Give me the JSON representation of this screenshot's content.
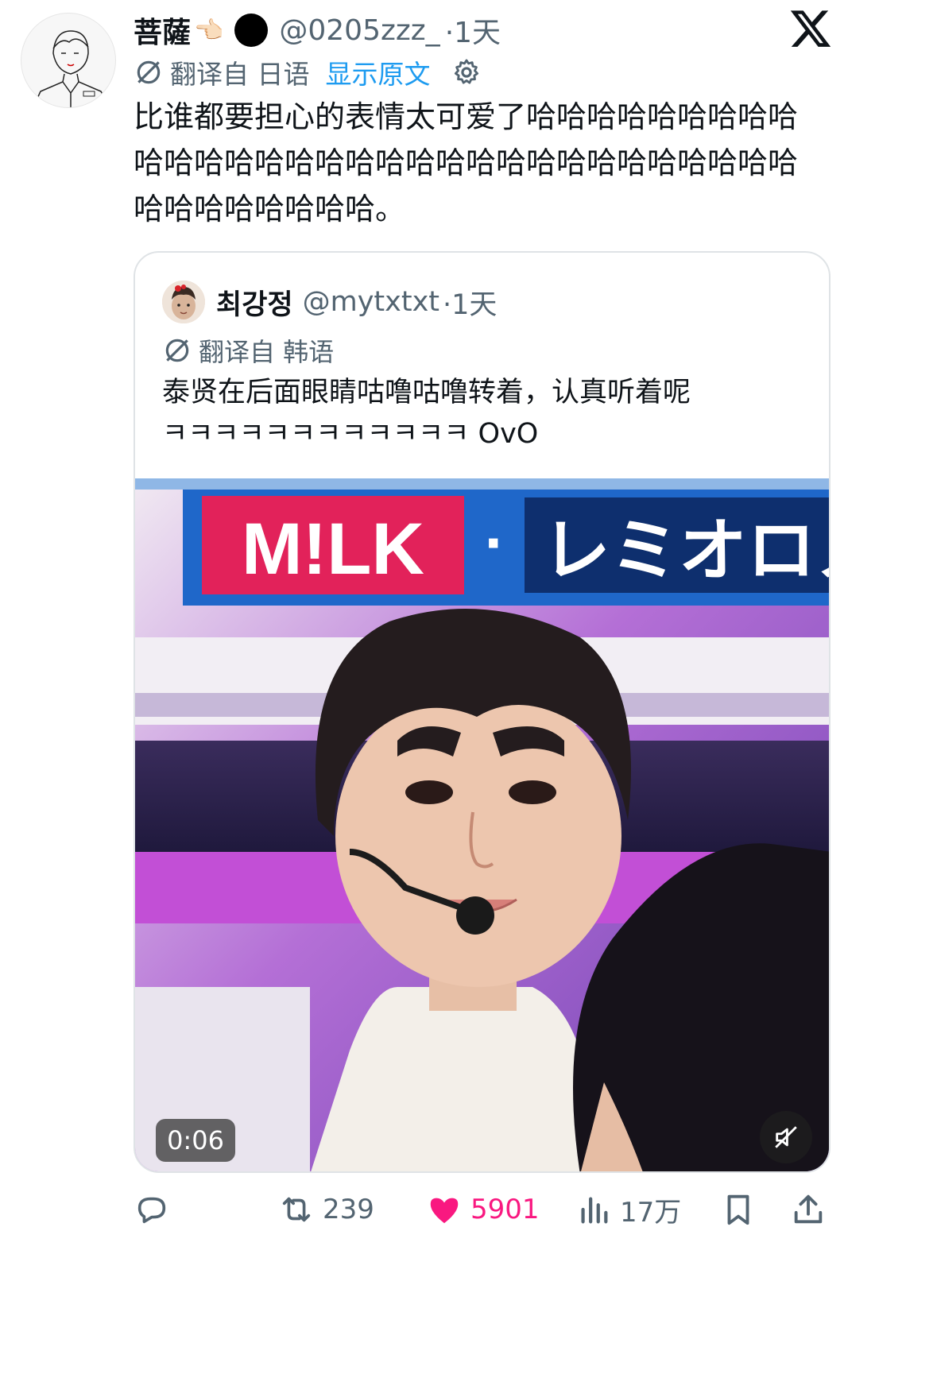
{
  "tweet": {
    "display_name": "菩薩",
    "handle": "@0205zzz_",
    "time": "·1天",
    "translation_label": "翻译自 日语",
    "show_original": "显示原文",
    "text": "比谁都要担心的表情太可爱了哈哈哈哈哈哈哈哈哈哈哈哈哈哈哈哈哈哈哈哈哈哈哈哈哈哈哈哈哈哈哈哈哈哈哈哈哈哈哈。"
  },
  "quote": {
    "display_name": "최강정",
    "handle": "@mytxtxt",
    "time": "·1天",
    "translation_label": "翻译自 韩语",
    "text_line1": "泰贤在后面眼睛咕噜咕噜转着，认真听着呢",
    "text_line2": "ㅋㅋㅋㅋㅋㅋㅋㅋㅋㅋㅋㅋ OvO",
    "video": {
      "banner_left": "M!LK",
      "banner_dot": "·",
      "banner_right": "レミオロメ",
      "duration": "0:06"
    }
  },
  "actions": {
    "reply_count": "",
    "retweet_count": "239",
    "like_count": "5901",
    "views_count": "17万"
  },
  "colors": {
    "accent": "#1d9bf0",
    "like": "#f91880",
    "secondary_text": "#536471"
  }
}
